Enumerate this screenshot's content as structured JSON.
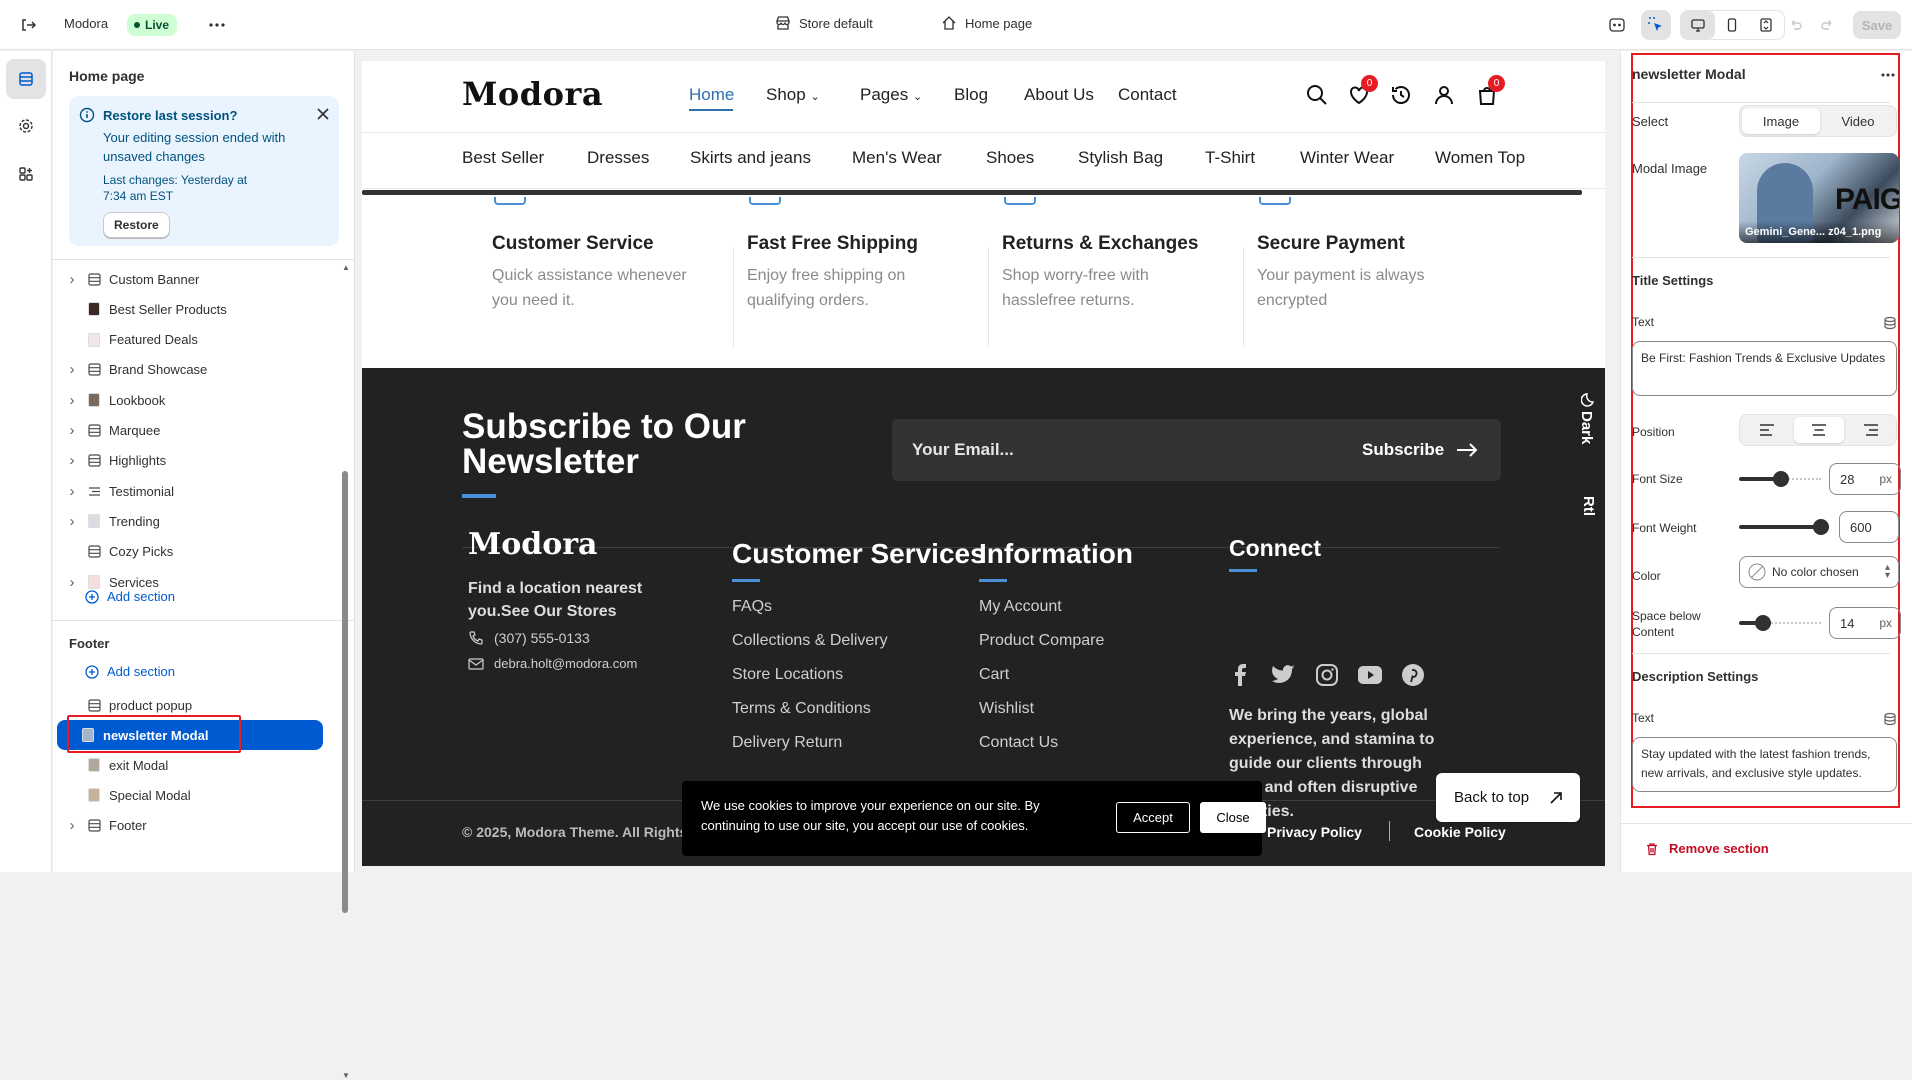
{
  "topbar": {
    "store_name": "Modora",
    "live_badge": "Live",
    "template_label": "Store default",
    "page_label": "Home page",
    "save_label": "Save"
  },
  "left": {
    "title": "Home page",
    "banner": {
      "title": "Restore last session?",
      "body": "Your editing session ended with unsaved changes",
      "last_changes": "Last changes: Yesterday at 7:34 am EST",
      "restore_label": "Restore"
    },
    "sections": [
      {
        "label": "Custom Banner",
        "expandable": true,
        "icon": "layout-icon"
      },
      {
        "label": "Best Seller Products",
        "expandable": false,
        "icon": "product-thumb-icon"
      },
      {
        "label": "Featured Deals",
        "expandable": false,
        "icon": "deal-thumb-icon"
      },
      {
        "label": "Brand Showcase",
        "expandable": true,
        "icon": "layout-icon"
      },
      {
        "label": "Lookbook",
        "expandable": true,
        "icon": "image-thumb-icon"
      },
      {
        "label": "Marquee",
        "expandable": true,
        "icon": "layout-icon"
      },
      {
        "label": "Highlights",
        "expandable": true,
        "icon": "layout-icon"
      },
      {
        "label": "Testimonial",
        "expandable": true,
        "icon": "list-icon"
      },
      {
        "label": "Trending",
        "expandable": true,
        "icon": "trending-thumb-icon"
      },
      {
        "label": "Cozy Picks",
        "expandable": false,
        "icon": "layout-icon"
      },
      {
        "label": "Services",
        "expandable": true,
        "icon": "services-thumb-icon"
      }
    ],
    "add_section_label": "Add section",
    "footer_title": "Footer",
    "footer_add_section_label": "Add section",
    "footer_items": [
      {
        "label": "product popup",
        "icon": "layout-icon",
        "expandable": false,
        "selected": false
      },
      {
        "label": "newsletter Modal",
        "icon": "modal-thumb-icon",
        "expandable": false,
        "selected": true
      },
      {
        "label": "exit Modal",
        "icon": "exit-thumb-icon",
        "expandable": false,
        "selected": false
      },
      {
        "label": "Special Modal",
        "icon": "special-thumb-icon",
        "expandable": false,
        "selected": false
      },
      {
        "label": "Footer",
        "icon": "layout-icon",
        "expandable": true,
        "selected": false
      }
    ]
  },
  "preview": {
    "logo": "Modora",
    "nav": [
      "Home",
      "Shop",
      "Pages",
      "Blog",
      "About Us",
      "Contact"
    ],
    "wishlist_count": "0",
    "cart_count": "0",
    "categories": [
      "Best Seller",
      "Dresses",
      "Skirts and jeans",
      "Men's Wear",
      "Shoes",
      "Stylish Bag",
      "T-Shirt",
      "Winter Wear",
      "Women Top"
    ],
    "services": [
      {
        "title": "Customer Service",
        "desc": "Quick assistance whenever you need it."
      },
      {
        "title": "Fast Free Shipping",
        "desc": "Enjoy free shipping on qualifying orders."
      },
      {
        "title": "Returns & Exchanges",
        "desc": "Shop worry-free with hasslefree returns."
      },
      {
        "title": "Secure Payment",
        "desc": "Your payment is always encrypted"
      }
    ],
    "newsletter": {
      "heading": "Subscribe to Our Newsletter",
      "email_placeholder": "Your Email...",
      "subscribe_label": "Subscribe"
    },
    "dark_toggle": "Dark",
    "rtl_toggle": "Rtl",
    "footer": {
      "logo": "Modora",
      "location_text": "Find a location nearest you.See Our Stores",
      "phone": "(307) 555-0133",
      "email": "debra.holt@modora.com",
      "col1_title": "Customer Services",
      "col1_links": [
        "FAQs",
        "Collections & Delivery",
        "Store Locations",
        "Terms & Conditions",
        "Delivery Return"
      ],
      "col2_title": "Information",
      "col2_links": [
        "My Account",
        "Product Compare",
        "Cart",
        "Wishlist",
        "Contact Us"
      ],
      "col3_title": "Connect",
      "connect_text": "We bring the years, global experience, and stamina to guide our clients through new and often disruptive realities.",
      "copyright": "© 2025, Modora Theme. All Rights",
      "privacy": "Privacy Policy",
      "cookie": "Cookie Policy"
    },
    "cookie_banner": {
      "text": "We use cookies to improve your experience on our site. By continuing to use our site, you accept our use of cookies.",
      "accept_label": "Accept",
      "close_label": "Close"
    },
    "back_to_top": "Back to top"
  },
  "right": {
    "title": "newsletter Modal",
    "select_label": "Select",
    "select_options": [
      "Image",
      "Video"
    ],
    "modal_image_label": "Modal Image",
    "modal_image_filename": "Gemini_Gene... z04_1.png",
    "title_settings": "Title Settings",
    "text_label": "Text",
    "title_text": "Be First: Fashion Trends & Exclusive Updates",
    "position_label": "Position",
    "font_size_label": "Font Size",
    "font_size_value": "28",
    "font_size_unit": "px",
    "font_weight_label": "Font Weight",
    "font_weight_value": "600",
    "color_label": "Color",
    "color_value": "No color chosen",
    "space_label": "Space below Content",
    "space_value": "14",
    "space_unit": "px",
    "description_settings": "Description Settings",
    "desc_text_label": "Text",
    "desc_text": "Stay updated with the latest fashion trends, new arrivals, and exclusive style updates.",
    "remove_label": "Remove section"
  },
  "colors": {
    "accent": "#005bd3",
    "highlight": "#e51c23",
    "banner_bg": "#eaf4ff",
    "footer_bg": "#222222",
    "badge_green": "#cdfed4",
    "link_blue": "#4a90d9"
  }
}
